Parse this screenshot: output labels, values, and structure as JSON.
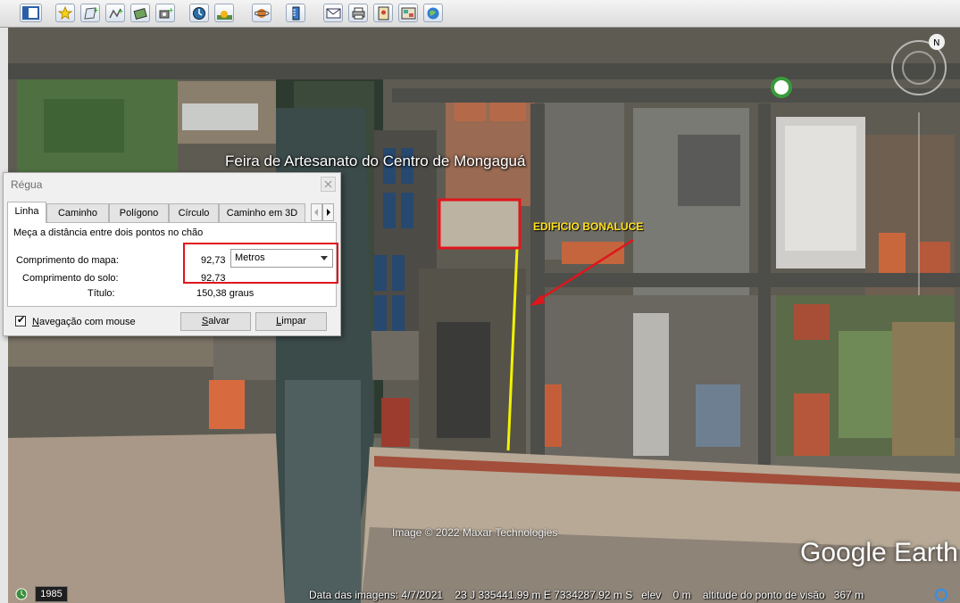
{
  "toolbar": {
    "buttons": [
      "sidebar-toggle-icon",
      "add-placemark-icon",
      "add-polygon-icon",
      "add-path-icon",
      "add-image-overlay-icon",
      "record-tour-icon",
      "historical-imagery-icon",
      "sunlight-icon",
      "planets-icon",
      "ruler-icon",
      "email-icon",
      "print-icon",
      "save-image-icon",
      "view-in-maps-icon",
      "earth-gallery-icon"
    ]
  },
  "map": {
    "poi_label": "Feira de Artesanato do Centro de Mongaguá",
    "annotation_label": "EDIFICIO BONALUCE",
    "copyright": "Image © 2022 Maxar Technologies",
    "logo": "Google Earth",
    "annotation_color": "#ffe01a",
    "highlight_color": "#e0151c",
    "ruler_line_color": "#f2f200"
  },
  "status": {
    "year": "1985",
    "text": "Data das imagens: 4/7/2021    23 J 335441.99 m E 7334287.92 m S   elev    0 m    altitude do ponto de visão   367 m"
  },
  "dialog": {
    "title": "Régua",
    "tabs": [
      "Linha",
      "Caminho",
      "Polígono",
      "Círculo",
      "Caminho em 3D"
    ],
    "active_tab": "Linha",
    "description": "Meça a distância entre dois pontos no chão",
    "map_length_label": "Comprimento do mapa:",
    "map_length_value": "92,73",
    "unit": "Metros",
    "ground_length_label": "Comprimento do solo:",
    "ground_length_value": "92,73",
    "heading_label": "Título:",
    "heading_value": "150,38 graus",
    "mouse_nav_prefix": "N",
    "mouse_nav_rest": "avegação com mouse",
    "mouse_nav_checked": true,
    "save_prefix": "S",
    "save_rest": "alvar",
    "clear_prefix": "L",
    "clear_rest": "impar"
  }
}
